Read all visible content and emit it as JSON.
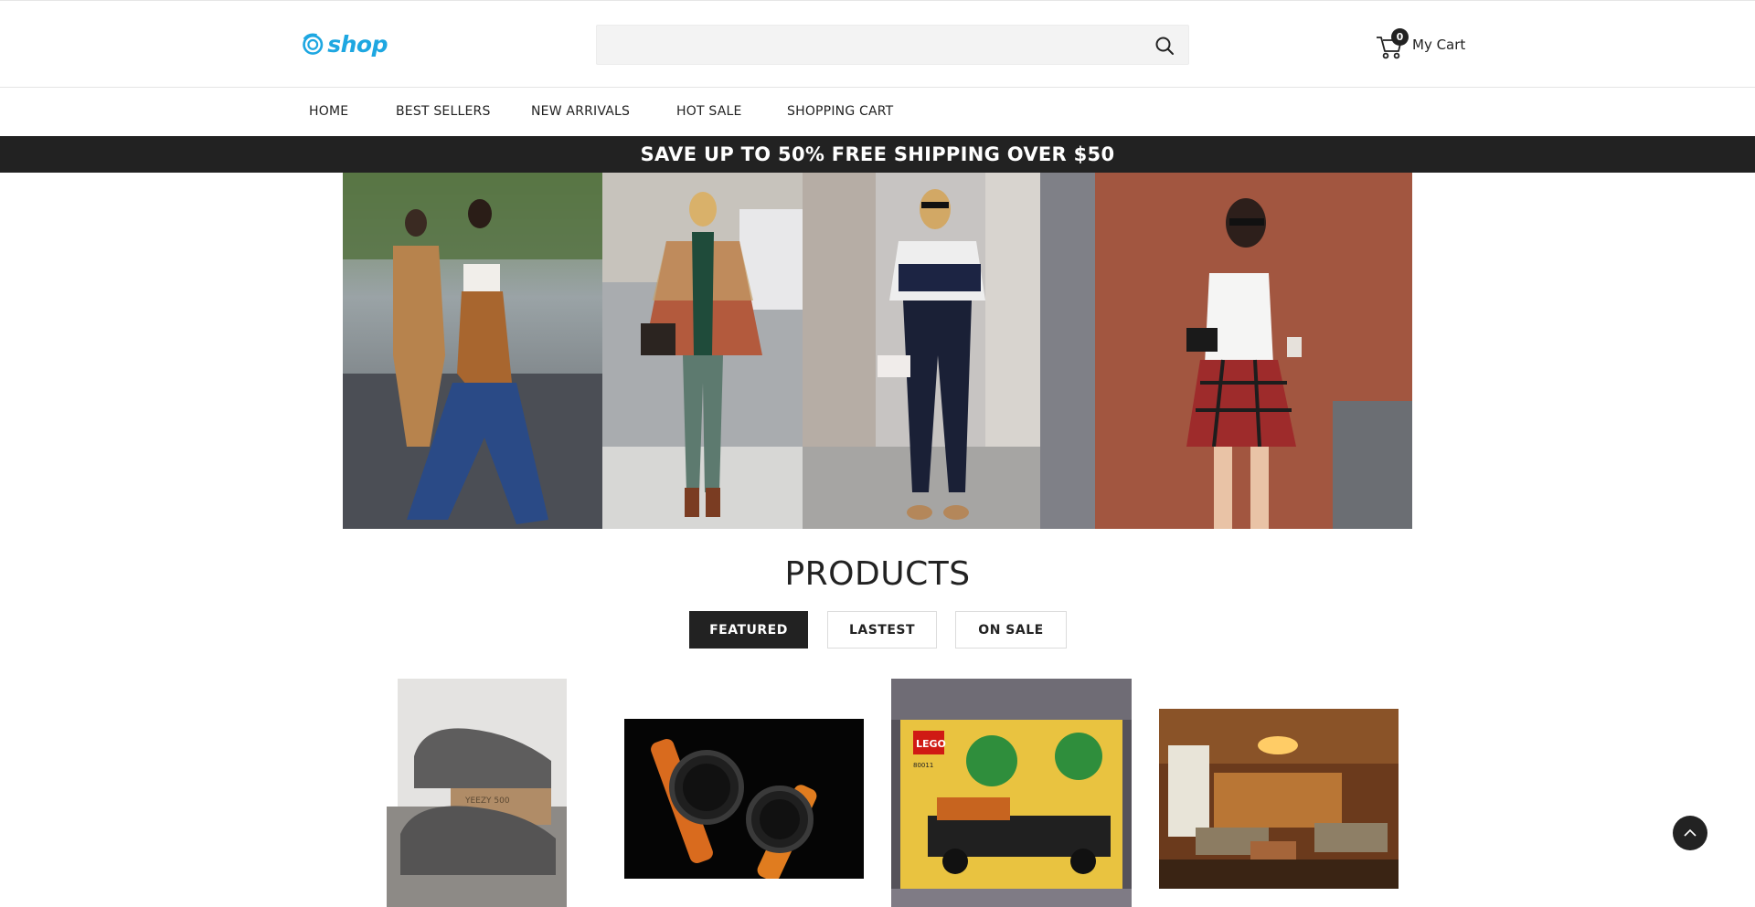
{
  "header": {
    "logo_text": "shop",
    "search": {
      "placeholder": "",
      "value": ""
    },
    "cart": {
      "count": "0",
      "label": "My Cart"
    }
  },
  "nav": {
    "items": [
      "HOME",
      "BEST SELLERS",
      "NEW ARRIVALS",
      "HOT SALE",
      "SHOPPING CART"
    ]
  },
  "promo": {
    "text": "SAVE UP TO 50% FREE SHIPPING OVER $50"
  },
  "products": {
    "title": "PRODUCTS",
    "tabs": [
      {
        "label": "FEATURED",
        "active": true
      },
      {
        "label": "LASTEST",
        "active": false
      },
      {
        "label": "ON SALE",
        "active": false
      }
    ],
    "items": [
      {
        "image": "sneakers-photo",
        "box_text": "YEEZY 500"
      },
      {
        "image": "watches-photo"
      },
      {
        "image": "lego-box-photo",
        "box_text": "LEGO",
        "code": "80011"
      },
      {
        "image": "living-room-photo"
      }
    ]
  },
  "colors": {
    "accent": "#1ea7e1",
    "dark": "#222222",
    "search_bg": "#f3f3f3"
  }
}
